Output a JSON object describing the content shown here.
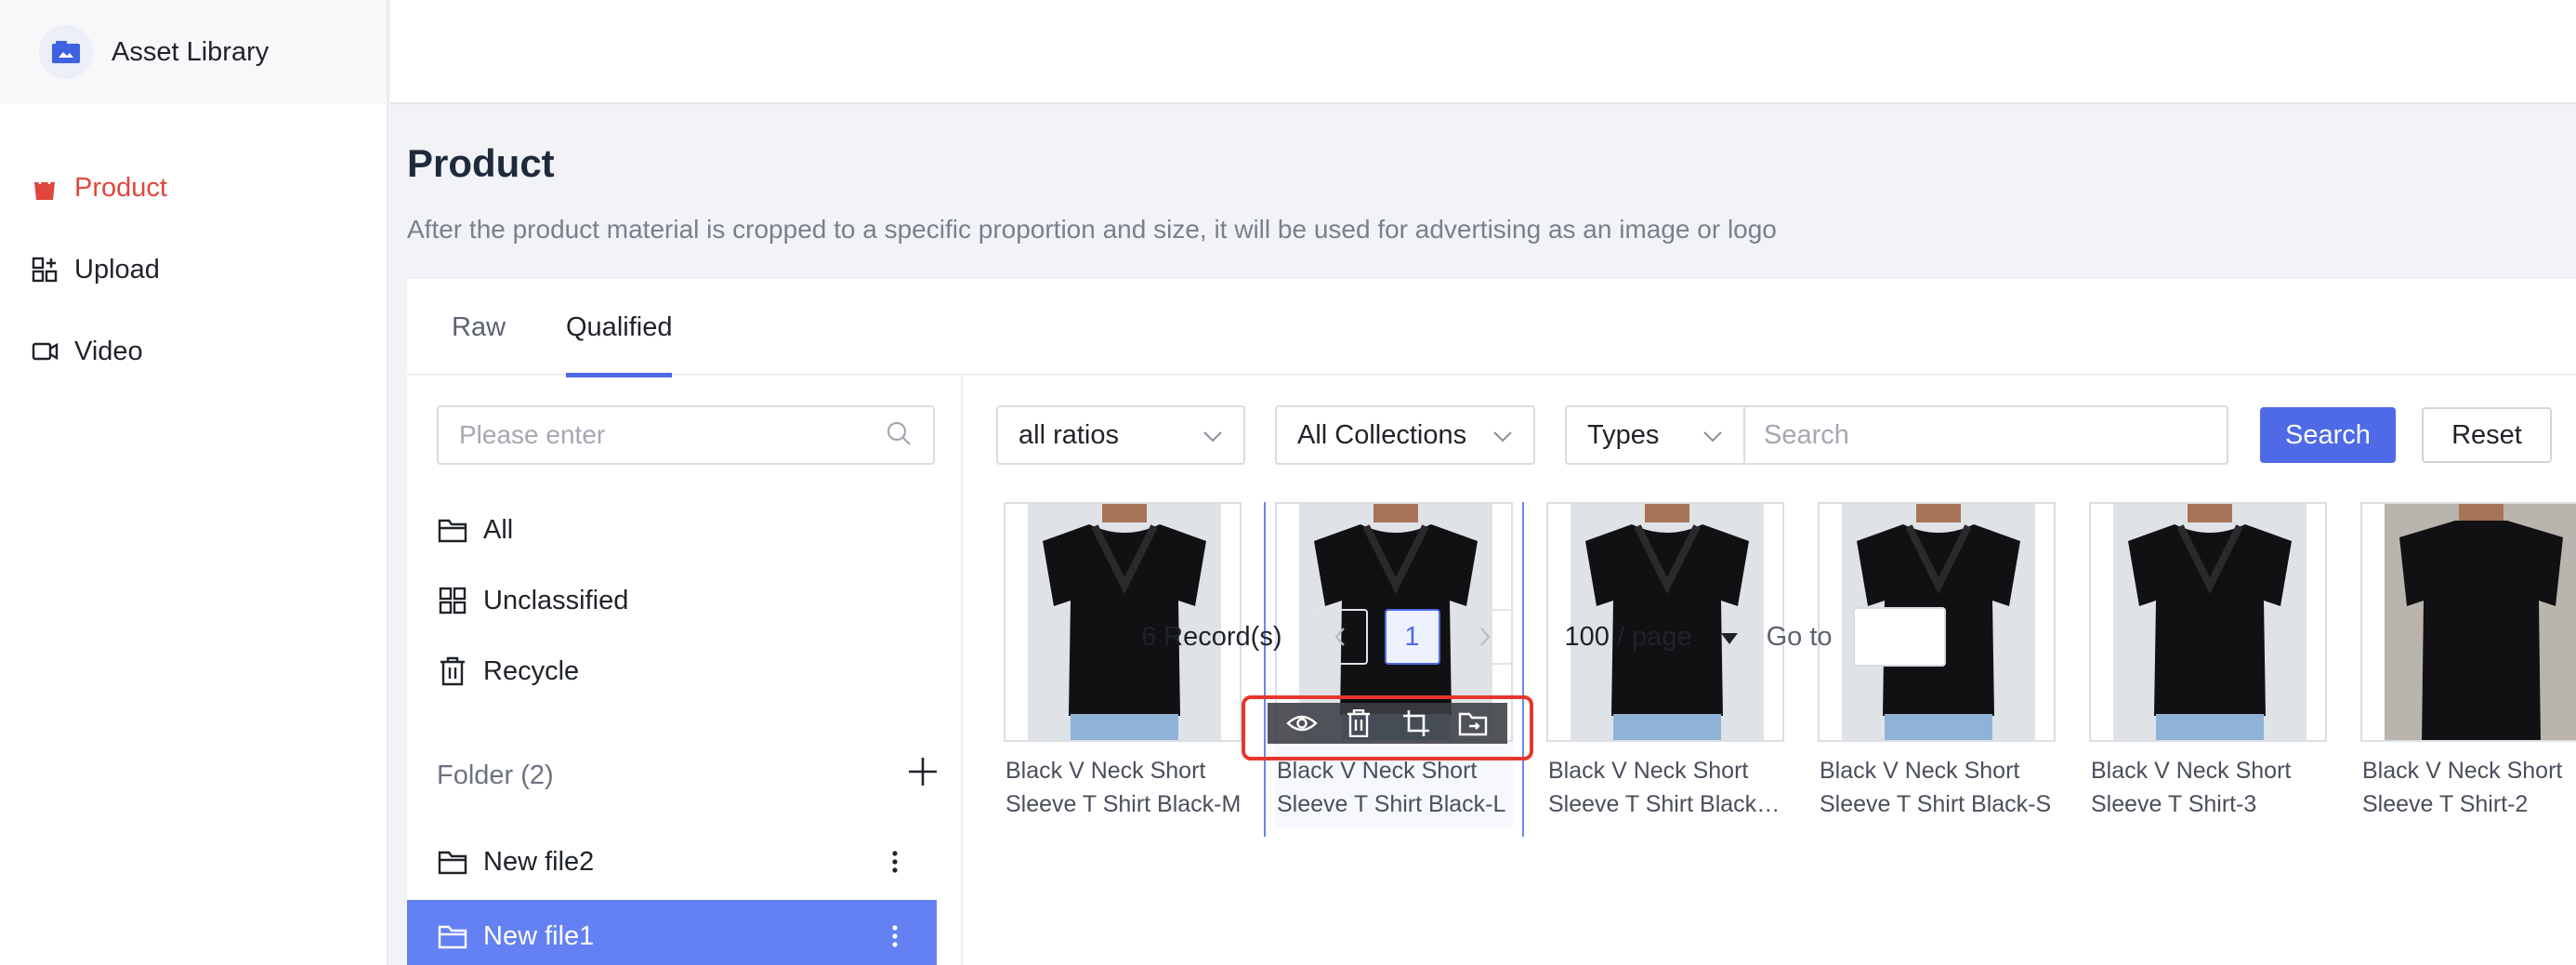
{
  "app": {
    "title": "Asset Library"
  },
  "sidebar": {
    "items": [
      {
        "label": "Product",
        "icon": "shopping-bag-icon",
        "active": true
      },
      {
        "label": "Upload",
        "icon": "apps-plus-icon"
      },
      {
        "label": "Video",
        "icon": "video-camera-icon"
      }
    ]
  },
  "page": {
    "title": "Product",
    "description": "After the product material is cropped to a specific proportion and size, it will be used for advertising as an image or logo"
  },
  "tabs": [
    {
      "label": "Raw"
    },
    {
      "label": "Qualified",
      "active": true
    }
  ],
  "folders": {
    "search_placeholder": "Please enter",
    "tree": [
      {
        "label": "All",
        "icon": "folder-icon"
      },
      {
        "label": "Unclassified",
        "icon": "grid-icon"
      },
      {
        "label": "Recycle",
        "icon": "trash-icon"
      }
    ],
    "header": "Folder (2)",
    "items": [
      {
        "label": "New file2"
      },
      {
        "label": "New file1",
        "selected": true
      }
    ]
  },
  "filters": {
    "ratio": "all ratios",
    "collections": "All Collections",
    "types": "Types",
    "search_placeholder": "Search",
    "search_button": "Search",
    "reset_button": "Reset"
  },
  "assets": [
    {
      "name": "Black V Neck Short Sleeve T Shirt Black-M"
    },
    {
      "name": "Black V Neck Short Sleeve T Shirt Black-L",
      "selected": true
    },
    {
      "name": "Black V Neck Short Sleeve T Shirt Black-XL"
    },
    {
      "name": "Black V Neck Short Sleeve T Shirt Black-S"
    },
    {
      "name": "Black V Neck Short Sleeve T Shirt-3"
    },
    {
      "name": "Black V Neck Short Sleeve T Shirt-2"
    }
  ],
  "hover_actions": [
    "eye-icon",
    "trash-icon",
    "crop-icon",
    "move-folder-icon"
  ],
  "pagination": {
    "total": "6 Record(s)",
    "current": "1",
    "page_size": "100 / page",
    "goto_label": "Go to"
  },
  "colors": {
    "accent": "#4e6ae6",
    "active_nav": "#e0463c",
    "selected_folder": "#6381f2",
    "highlight": "#e5372b"
  }
}
